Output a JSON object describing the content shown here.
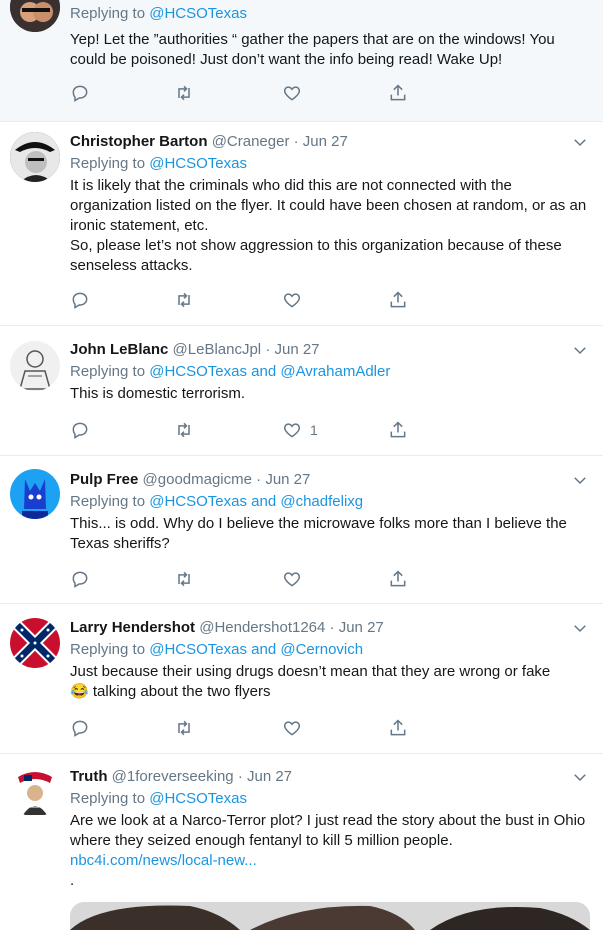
{
  "tweets": [
    {
      "reply_prefix": "Replying to",
      "mentions": [
        "@HCSOTexas"
      ],
      "body": [
        "Yep! Let the ”authorities “ gather the papers that are on the windows! You could be poisoned! Just don’t want the info being read! Wake Up!"
      ]
    },
    {
      "name": "Christopher Barton",
      "handle": "@Craneger",
      "date": "Jun 27",
      "reply_prefix": "Replying to",
      "mentions": [
        "@HCSOTexas"
      ],
      "body": [
        "It is likely that the criminals who did this are not connected with the organization listed on the flyer. It could have been chosen at random, or as an ironic statement, etc.",
        "So, please let’s not show aggression to this organization because of these senseless attacks."
      ]
    },
    {
      "name": "John LeBlanc",
      "handle": "@LeBlancJpl",
      "date": "Jun 27",
      "reply_prefix": "Replying to",
      "mentions": [
        "@HCSOTexas",
        "@AvrahamAdler"
      ],
      "joiner": "and",
      "body": [
        "This is domestic terrorism."
      ],
      "like_count": "1"
    },
    {
      "name": "Pulp Free",
      "handle": "@goodmagicme",
      "date": "Jun 27",
      "reply_prefix": "Replying to",
      "mentions": [
        "@HCSOTexas",
        "@chadfelixg"
      ],
      "joiner": "and",
      "body": [
        "This... is odd. Why do I believe the microwave folks more than I believe the Texas sheriffs?"
      ]
    },
    {
      "name": "Larry Hendershot",
      "handle": "@Hendershot1264",
      "date": "Jun 27",
      "reply_prefix": "Replying to",
      "mentions": [
        "@HCSOTexas",
        "@Cernovich"
      ],
      "joiner": "and",
      "body": [
        "Just because their using drugs doesn’t mean that they are wrong or fake"
      ],
      "body_line2": "talking about the two flyers",
      "emoji": "😂"
    },
    {
      "name": "Truth",
      "handle": "@1foreverseeking",
      "date": "Jun 27",
      "reply_prefix": "Replying to",
      "mentions": [
        "@HCSOTexas"
      ],
      "body": [
        "Are we look at a Narco-Terror plot? I just read the story about the bust in Ohio where they seized enough fentanyl to kill 5 million people."
      ],
      "link": "nbc4i.com/news/local-new...",
      "trailing": "."
    }
  ],
  "separator": "·",
  "icons": [
    "reply-icon",
    "retweet-icon",
    "like-icon",
    "share-icon",
    "chevron-down-icon"
  ],
  "colors": {
    "link": "#1b95e0",
    "muted": "#657786",
    "border": "#e6ecf0",
    "highlight_bg": "#f5f8fa"
  }
}
